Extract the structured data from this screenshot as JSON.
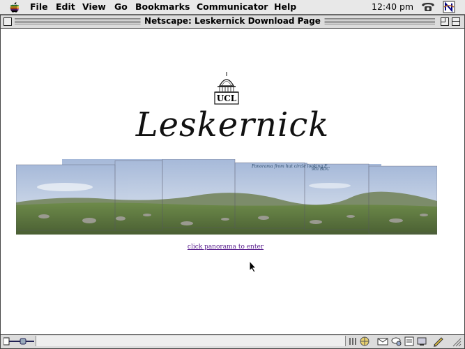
{
  "menubar": {
    "items": [
      "File",
      "Edit",
      "View",
      "Go",
      "Bookmarks",
      "Communicator",
      "Help"
    ],
    "clock": "12:40 pm"
  },
  "window": {
    "title": "Netscape: Leskernick Download Page"
  },
  "page": {
    "logo_text": "UCL",
    "title": "Leskernick",
    "link_text": "click panorama to enter",
    "panorama": {
      "handwritten_notes": [
        "Panorama from hut circle looking E",
        "9th BDC"
      ]
    }
  },
  "statusbar": {
    "status_text": "",
    "icons": [
      "security-lock-icon",
      "component-bar-icons",
      "navigator-icon",
      "mail-icon",
      "discussion-icon",
      "composer-icon",
      "edit-icon"
    ]
  }
}
